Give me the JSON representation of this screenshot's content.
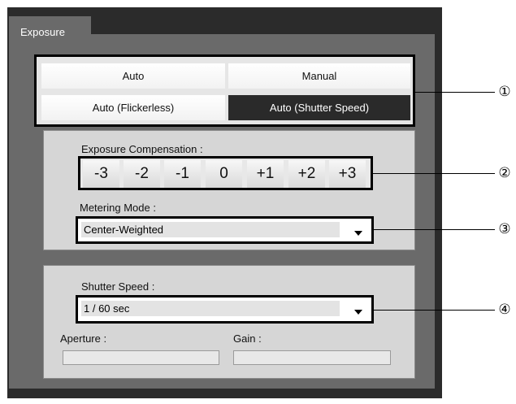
{
  "tab": {
    "label": "Exposure"
  },
  "modes": [
    {
      "label": "Auto",
      "selected": false
    },
    {
      "label": "Manual",
      "selected": false
    },
    {
      "label": "Auto (Flickerless)",
      "selected": false
    },
    {
      "label": "Auto (Shutter Speed)",
      "selected": true
    }
  ],
  "compensation": {
    "label": "Exposure Compensation :",
    "values": [
      "-3",
      "-2",
      "-1",
      "0",
      "+1",
      "+2",
      "+3"
    ]
  },
  "metering": {
    "label": "Metering Mode :",
    "value": "Center-Weighted"
  },
  "shutter": {
    "label": "Shutter Speed :",
    "value": "1 / 60 sec"
  },
  "aperture": {
    "label": "Aperture :",
    "value": ""
  },
  "gain": {
    "label": "Gain :",
    "value": ""
  },
  "callouts": [
    "①",
    "②",
    "③",
    "④"
  ],
  "colors": {
    "selected_bg": "#2a2a2a",
    "panel_bg": "#6a6a6a",
    "outer_bg": "#2b2b2b"
  }
}
